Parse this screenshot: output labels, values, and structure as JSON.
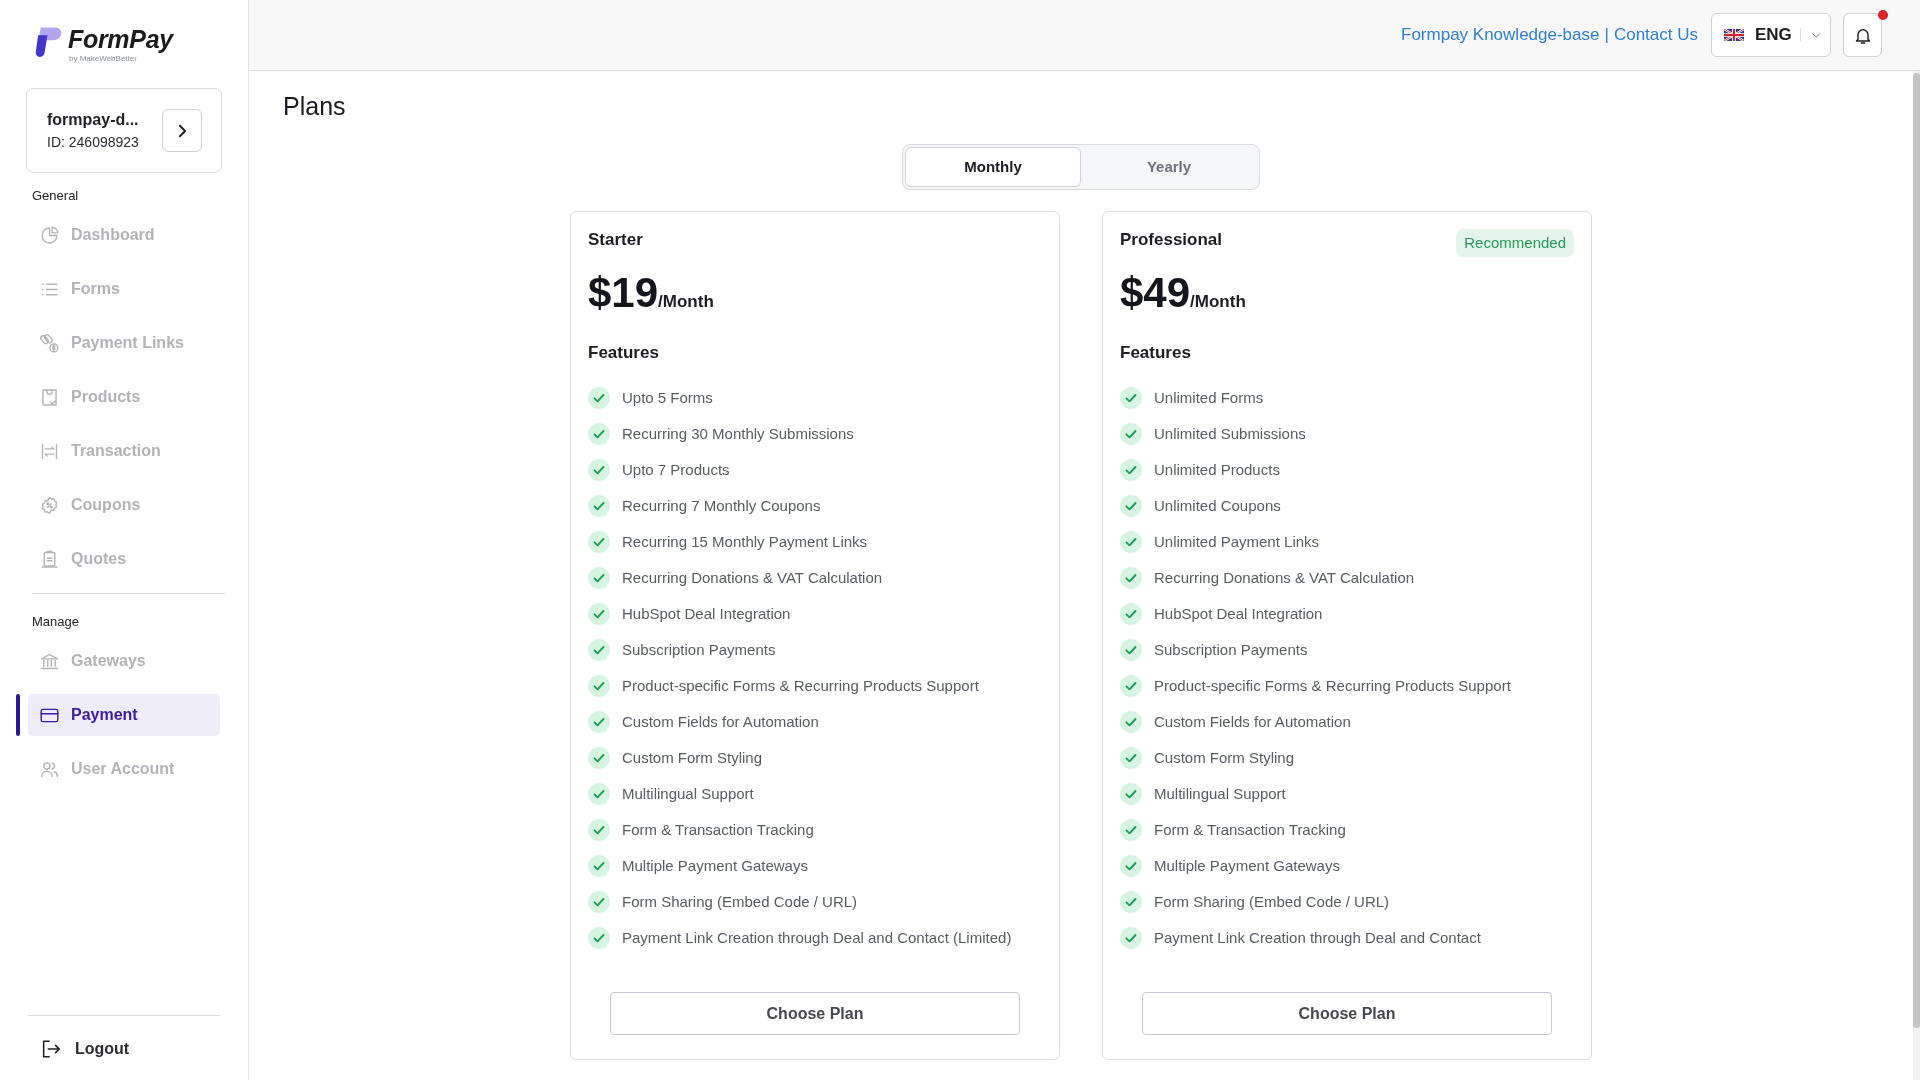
{
  "logo": {
    "name": "FormPay",
    "tagline": "by MakeWebBetter"
  },
  "account": {
    "name": "formpay-d...",
    "id": "ID: 246098923"
  },
  "sidebar": {
    "sections": [
      {
        "title": "General",
        "items": [
          {
            "label": "Dashboard",
            "selected": false
          },
          {
            "label": "Forms",
            "selected": false
          },
          {
            "label": "Payment Links",
            "selected": false
          },
          {
            "label": "Products",
            "selected": false
          },
          {
            "label": "Transaction",
            "selected": false
          },
          {
            "label": "Coupons",
            "selected": false
          },
          {
            "label": "Quotes",
            "selected": false
          }
        ]
      },
      {
        "title": "Manage",
        "items": [
          {
            "label": "Gateways",
            "selected": false
          },
          {
            "label": "Payment",
            "selected": true
          },
          {
            "label": "User Account",
            "selected": false
          }
        ]
      }
    ],
    "logout": "Logout"
  },
  "header": {
    "links": [
      "Formpay Knowledge-base",
      "Contact Us"
    ],
    "separator": "|",
    "language": "ENG",
    "notifications": {
      "unread": true
    }
  },
  "page": {
    "title": "Plans"
  },
  "billing_tabs": [
    {
      "label": "Monthly",
      "selected": true
    },
    {
      "label": "Yearly",
      "selected": false
    }
  ],
  "plans": [
    {
      "name": "Starter",
      "price": "$19",
      "period": "/Month",
      "features_title": "Features",
      "features": [
        "Upto 5 Forms",
        "Recurring 30 Monthly Submissions",
        "Upto 7 Products",
        "Recurring 7 Monthly Coupons",
        "Recurring 15 Monthly Payment Links",
        "Recurring Donations & VAT Calculation",
        "HubSpot Deal Integration",
        "Subscription Payments",
        "Product-specific Forms & Recurring Products Support",
        "Custom Fields for Automation",
        "Custom Form Styling",
        "Multilingual Support",
        "Form & Transaction Tracking",
        "Multiple Payment Gateways",
        "Form Sharing (Embed Code / URL)",
        "Payment Link Creation through Deal and Contact (Limited)"
      ],
      "button": "Choose Plan"
    },
    {
      "name": "Professional",
      "badge": "Recommended",
      "price": "$49",
      "period": "/Month",
      "features_title": "Features",
      "features": [
        "Unlimited Forms",
        "Unlimited Submissions",
        "Unlimited Products",
        "Unlimited Coupons",
        "Unlimited Payment Links",
        "Recurring Donations & VAT Calculation",
        "HubSpot Deal Integration",
        "Subscription Payments",
        "Product-specific Forms & Recurring Products Support",
        "Custom Fields for Automation",
        "Custom Form Styling",
        "Multilingual Support",
        "Form & Transaction Tracking",
        "Multiple Payment Gateways",
        "Form Sharing (Embed Code / URL)",
        "Payment Link Creation through Deal and Contact"
      ],
      "button": "Choose Plan"
    }
  ]
}
